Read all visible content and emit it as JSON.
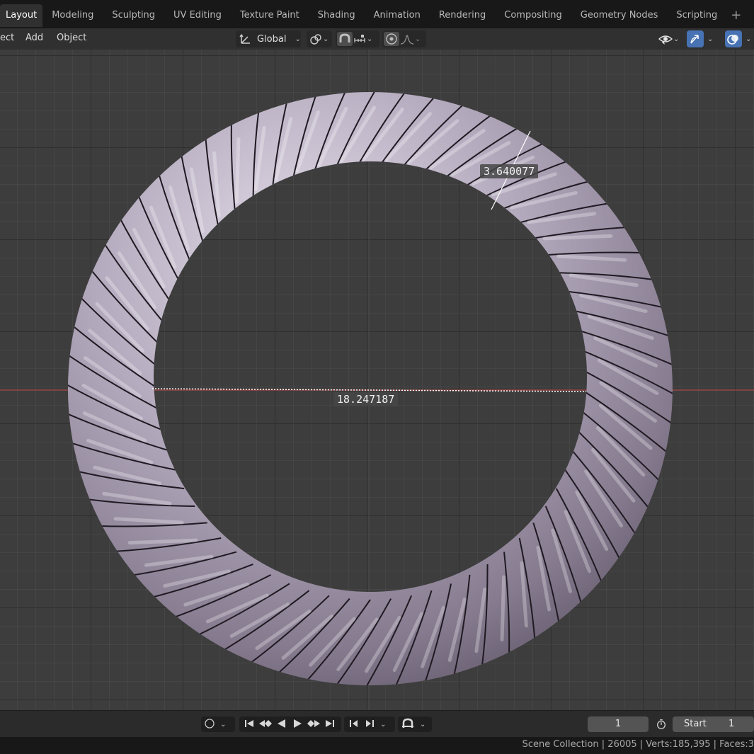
{
  "workspace_tabs": [
    "Layout",
    "Modeling",
    "Sculpting",
    "UV Editing",
    "Texture Paint",
    "Shading",
    "Animation",
    "Rendering",
    "Compositing",
    "Geometry Nodes",
    "Scripting"
  ],
  "active_tab": "Layout",
  "header": {
    "menu": [
      "ect",
      "Add",
      "Object"
    ],
    "transform_orientation": "Global"
  },
  "measurements": {
    "diameter": "18.247187",
    "thickness": "3.640077"
  },
  "timeline": {
    "current_frame": "1",
    "start_label": "Start",
    "start_value": "1"
  },
  "status": {
    "text": "Scene Collection | 26005 | Verts:185,395 | Faces:3"
  },
  "colors": {
    "x_axis": "#c44848",
    "accent_blue": "#4772b3",
    "ring_base": "#b6acbe",
    "grid_bg": "#3d3d3d"
  },
  "icons": [
    "add-tab-icon",
    "transform-orientation-icon",
    "pivot-icon",
    "snap-icon",
    "snap-target-icon",
    "proportional-edit-icon",
    "falloff-icon",
    "visibility-icon",
    "gizmo-icon",
    "overlay-icon",
    "record-icon",
    "jump-start-icon",
    "prev-keyframe-icon",
    "play-reverse-icon",
    "play-icon",
    "next-keyframe-icon",
    "jump-end-icon",
    "prev-frame-icon",
    "next-frame-icon",
    "auto-key-icon",
    "stopwatch-icon"
  ]
}
